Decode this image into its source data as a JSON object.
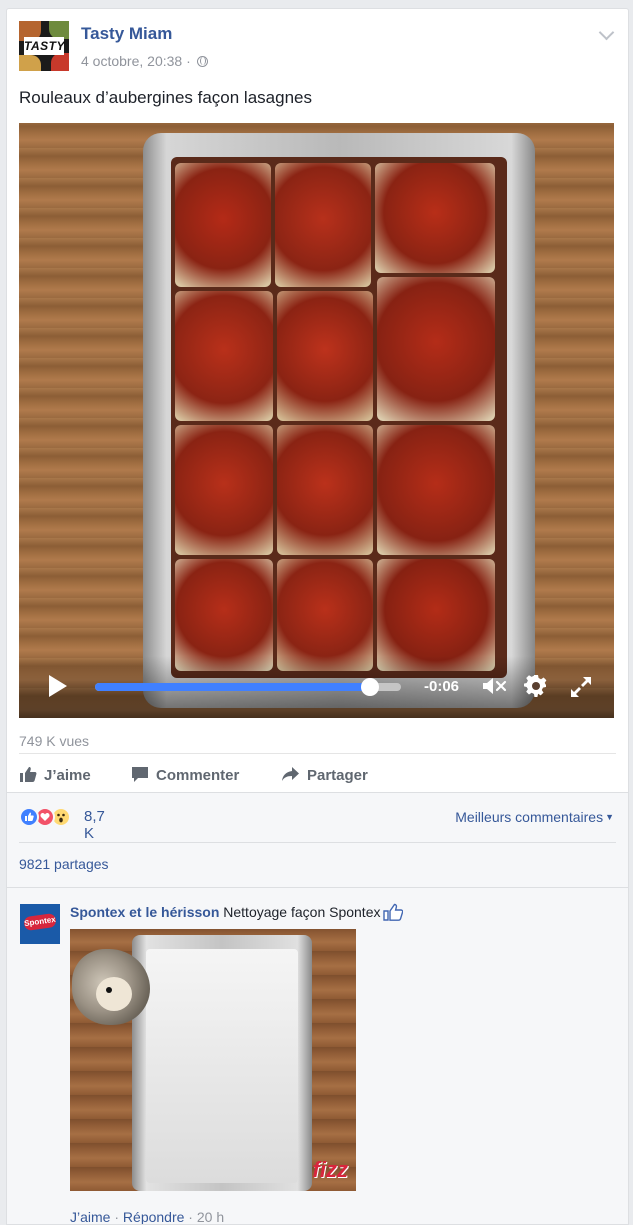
{
  "post": {
    "page_name": "Tasty Miam",
    "avatar_logo": "TASTY",
    "timestamp": "4 octobre, 20:38 · ",
    "text": "Rouleaux d’aubergines façon lasagnes"
  },
  "video": {
    "time_remaining": "-0:06",
    "progress": 0.9,
    "controls": [
      "play-icon",
      "mute-icon",
      "gear-icon",
      "expand-icon"
    ]
  },
  "views": "749 K vues",
  "actions": {
    "like": "J’aime",
    "comment": "Commenter",
    "share": "Partager"
  },
  "feedback": {
    "reaction_count": "8,7 K",
    "reaction_icons": [
      "like-icon",
      "love-icon",
      "wow-icon"
    ],
    "top_comments": "Meilleurs commentaires",
    "shares": "9821 partages"
  },
  "comment": {
    "author": "Spontex et le hérisson",
    "text": "Nettoyage façon Spontex",
    "avatar_badge": "Spontex",
    "image_logo": "fizz",
    "like_label": "J’aime",
    "separator": " · ",
    "reply_label": "Répondre",
    "time": "20 h"
  },
  "colors": {
    "link": "#365899",
    "muted": "#90949c",
    "accent_blue": "#4080ff",
    "love_red": "#f25268",
    "wow_yellow": "#ffd972"
  }
}
